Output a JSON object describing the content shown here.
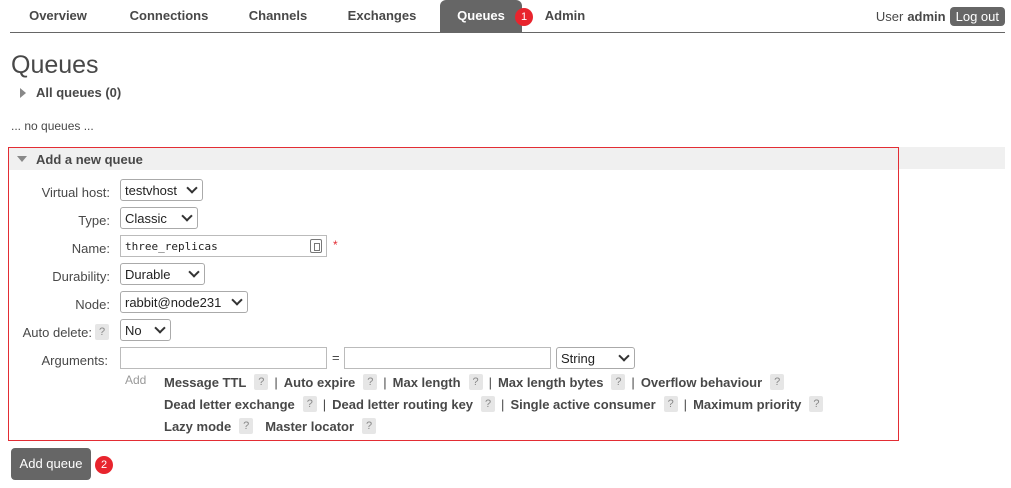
{
  "nav": {
    "tabs": [
      {
        "label": "Overview"
      },
      {
        "label": "Connections"
      },
      {
        "label": "Channels"
      },
      {
        "label": "Exchanges"
      },
      {
        "label": "Queues"
      },
      {
        "label": "Admin"
      }
    ],
    "active_tab": "Queues",
    "marker_1": "1",
    "user_label": "User",
    "user_name": "admin",
    "logout_label": "Log out"
  },
  "page": {
    "title": "Queues",
    "all_queues_label": "All queues (0)",
    "no_queues_text": "... no queues ..."
  },
  "add_queue_panel": {
    "header": "Add a new queue",
    "fields": {
      "virtual_host": {
        "label": "Virtual host:",
        "value": "testvhost"
      },
      "type": {
        "label": "Type:",
        "value": "Classic"
      },
      "name": {
        "label": "Name:",
        "value": "three_replicas",
        "required_mark": "*"
      },
      "durability": {
        "label": "Durability:",
        "value": "Durable"
      },
      "node": {
        "label": "Node:",
        "value": "rabbit@node231"
      },
      "auto_delete": {
        "label": "Auto delete:",
        "value": "No",
        "help": "?"
      },
      "arguments": {
        "label": "Arguments:",
        "key_value": "",
        "val_value": "",
        "equals": "=",
        "type_value": "String"
      }
    },
    "add_label": "Add",
    "argument_links": [
      {
        "label": "Message TTL",
        "help": "?"
      },
      {
        "label": "Auto expire",
        "help": "?"
      },
      {
        "label": "Max length",
        "help": "?"
      },
      {
        "label": "Max length bytes",
        "help": "?"
      },
      {
        "label": "Overflow behaviour",
        "help": "?"
      },
      {
        "label": "Dead letter exchange",
        "help": "?"
      },
      {
        "label": "Dead letter routing key",
        "help": "?"
      },
      {
        "label": "Single active consumer",
        "help": "?"
      },
      {
        "label": "Maximum priority",
        "help": "?"
      },
      {
        "label": "Lazy mode",
        "help": "?"
      },
      {
        "label": "Master locator",
        "help": "?"
      }
    ],
    "separator": "|"
  },
  "add_queue_button": {
    "label": "Add queue",
    "marker": "2"
  },
  "colors": {
    "tab_active_bg": "#666666",
    "marker": "#e8242d",
    "highlight_border": "#e32d34",
    "button_bg": "#666666"
  }
}
